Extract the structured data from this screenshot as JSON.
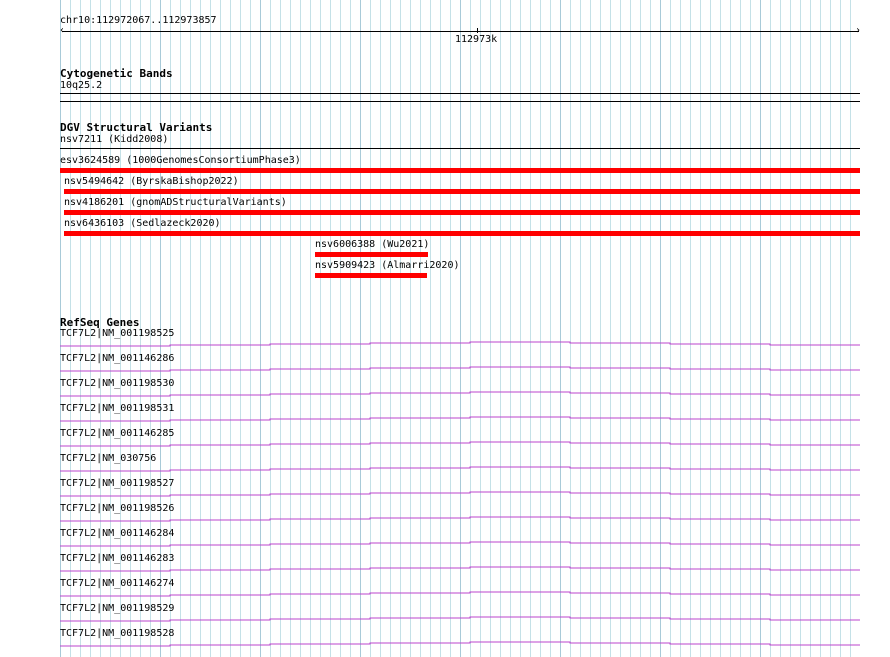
{
  "ruler": {
    "location": "chr10:112972067..112973857",
    "tick_label": "112973k"
  },
  "cytoband": {
    "title": "Cytogenetic Bands",
    "band": "10q25.2"
  },
  "dgv": {
    "title": "DGV Structural Variants",
    "features": [
      {
        "label": "nsv7211 (Kidd2008)",
        "bar": false
      },
      {
        "label": "esv3624589 (1000GenomesConsortiumPhase3)",
        "bar": true
      },
      {
        "label": "nsv5494642 (ByrskaBishop2022)",
        "bar": true
      },
      {
        "label": "nsv4186201 (gnomADStructuralVariants)",
        "bar": true
      },
      {
        "label": "nsv6436103 (Sedlazeck2020)",
        "bar": true
      },
      {
        "label": "nsv6006388 (Wu2021)",
        "bar": true
      },
      {
        "label": "nsv5909423 (Almarri2020)",
        "bar": true
      }
    ]
  },
  "refseq": {
    "title": "RefSeq Genes",
    "transcripts": [
      "TCF7L2|NM_001198525",
      "TCF7L2|NM_001146286",
      "TCF7L2|NM_001198530",
      "TCF7L2|NM_001198531",
      "TCF7L2|NM_001146285",
      "TCF7L2|NM_030756",
      "TCF7L2|NM_001198527",
      "TCF7L2|NM_001198526",
      "TCF7L2|NM_001146284",
      "TCF7L2|NM_001146283",
      "TCF7L2|NM_001146274",
      "TCF7L2|NM_001198529",
      "TCF7L2|NM_001198528"
    ],
    "color": "#bb44cc"
  },
  "colors": {
    "variant": "#ff0000",
    "grid_major": "#a8cad8",
    "grid_minor": "#c4e1e7"
  }
}
